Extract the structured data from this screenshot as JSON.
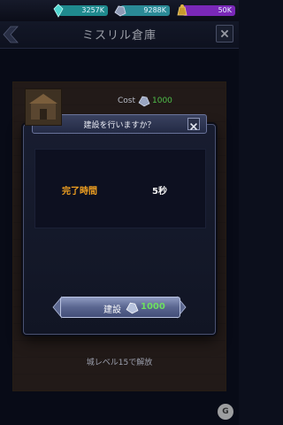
{
  "resources": [
    {
      "icon": "crystal-icon",
      "value": "3257K"
    },
    {
      "icon": "ore-icon",
      "value": "9288K"
    },
    {
      "icon": "coin-bag-icon",
      "value": "50K"
    }
  ],
  "header": {
    "title": "ミスリル倉庫"
  },
  "background": {
    "cost_label": "Cost",
    "cost_value": "1000",
    "unlock_text": "城レベル15で解放"
  },
  "modal": {
    "title": "建設を行いますか？",
    "time_label": "完了時間",
    "time_value": "5秒",
    "build_label": "建設",
    "build_cost": "1000"
  },
  "colors": {
    "accent_orange": "#f0a020",
    "cost_green": "#6de060",
    "crystal": "#1f8a8e",
    "purple": "#7a28b8"
  }
}
